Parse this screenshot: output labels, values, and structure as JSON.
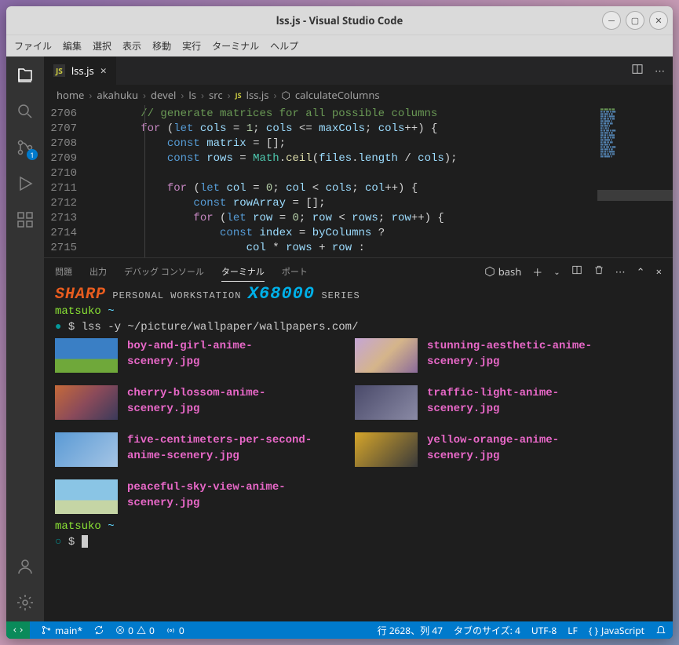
{
  "title": "lss.js - Visual Studio Code",
  "menubar": [
    "ファイル",
    "編集",
    "選択",
    "表示",
    "移動",
    "実行",
    "ターミナル",
    "ヘルプ"
  ],
  "scm_badge": "1",
  "tab": {
    "icon": "JS",
    "label": "lss.js"
  },
  "breadcrumb": [
    "home",
    "akahuku",
    "devel",
    "ls",
    "src"
  ],
  "breadcrumb_file": {
    "icon": "JS",
    "name": "lss.js"
  },
  "breadcrumb_symbol": "calculateColumns",
  "line_numbers": [
    "2706",
    "2707",
    "2708",
    "2709",
    "2710",
    "2711",
    "2712",
    "2713",
    "2714",
    "2715"
  ],
  "panel": {
    "tabs": [
      "問題",
      "出力",
      "デバッグ コンソール",
      "ターミナル",
      "ポート"
    ],
    "active": 3,
    "shell": "bash"
  },
  "term": {
    "brand": "SHARP",
    "ws1": "PERSONAL WORKSTATION",
    "x68": "X68000",
    "ws2": "SERIES",
    "prompt_user": "matsuko",
    "prompt_path": "~",
    "dollar": "$",
    "command": "lss -y ~/picture/wallpaper/wallpapers.com/",
    "files_left": [
      "boy-and-girl-anime-scenery.jpg",
      "cherry-blossom-anime-scenery.jpg",
      "five-centimeters-per-second-anime-scenery.jpg",
      "peaceful-sky-view-anime-scenery.jpg"
    ],
    "files_right": [
      "stunning-aesthetic-anime-scenery.jpg",
      "traffic-light-anime-scenery.jpg",
      "yellow-orange-anime-scenery.jpg"
    ]
  },
  "status": {
    "branch": "main*",
    "sync": "",
    "errors": "0",
    "warnings": "0",
    "ports": "0",
    "lncol": "行 2628、列 47",
    "tabsize": "タブのサイズ: 4",
    "encoding": "UTF-8",
    "eol": "LF",
    "lang": "JavaScript"
  }
}
